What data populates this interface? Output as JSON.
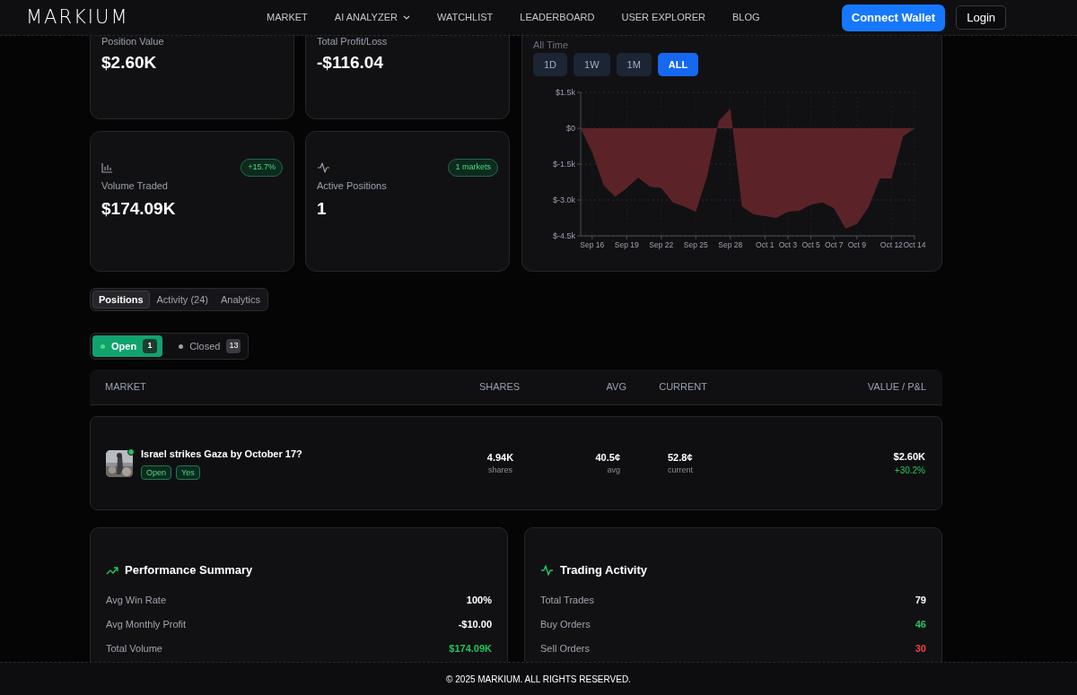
{
  "header": {
    "logo": "MARKIUM",
    "nav": [
      {
        "label": "MARKET",
        "dropdown": false
      },
      {
        "label": "AI ANALYZER",
        "dropdown": true
      },
      {
        "label": "WATCHLIST",
        "dropdown": false
      },
      {
        "label": "LEADERBOARD",
        "dropdown": false
      },
      {
        "label": "USER EXPLORER",
        "dropdown": false
      },
      {
        "label": "BLOG",
        "dropdown": false
      }
    ],
    "connect_button": "Connect Wallet",
    "login_button": "Login"
  },
  "stats": [
    {
      "label": "Position Value",
      "value": "$2.60K"
    },
    {
      "label": "Total Profit/Loss",
      "value": "-$116.04"
    },
    {
      "kind": "volume",
      "label": "Volume Traded",
      "value": "$174.09K",
      "badge": "+15.7%"
    },
    {
      "kind": "activity",
      "label": "Active Positions",
      "value": "1",
      "badge": "1 markets"
    }
  ],
  "chart_panel": {
    "period_label": "All Time",
    "ranges": [
      {
        "label": "1D",
        "selected": false
      },
      {
        "label": "1W",
        "selected": false
      },
      {
        "label": "1M",
        "selected": false
      },
      {
        "label": "ALL",
        "selected": true
      }
    ],
    "chart_data": {
      "type": "area",
      "categories": [
        null,
        "Sep 16",
        null,
        null,
        "Sep 19",
        null,
        null,
        "Sep 22",
        null,
        null,
        "Sep 25",
        null,
        null,
        "Sep 28",
        null,
        null,
        "Oct 1",
        null,
        "Oct 3",
        null,
        "Oct 5",
        null,
        "Oct 7",
        null,
        "Oct 9",
        null,
        null,
        "Oct 12",
        null,
        "Oct 14"
      ],
      "series": [
        {
          "color": "#5b2327",
          "values": [
            0,
            -1000,
            -2400,
            -2870,
            -2500,
            -2060,
            -2450,
            -2500,
            -3100,
            -3270,
            -3500,
            -2000,
            300,
            820,
            -3270,
            -3600,
            -3670,
            -3750,
            -3500,
            -3450,
            -3200,
            -3100,
            -3350,
            -4200,
            -4000,
            -3300,
            -2100,
            -2100,
            -350,
            0
          ]
        }
      ],
      "grid": true,
      "ylim": [
        -4500,
        1500
      ],
      "yticks": [
        {
          "value": 1500,
          "label": "$1.5k"
        },
        {
          "value": 0,
          "label": "$0"
        },
        {
          "value": -1500,
          "label": "$-1.5k"
        },
        {
          "value": -3000,
          "label": "$-3.0k"
        },
        {
          "value": -4500,
          "label": "$-4.5k"
        }
      ]
    }
  },
  "tabs": [
    {
      "label": "Positions",
      "selected": true
    },
    {
      "label": "Activity (24)",
      "selected": false
    },
    {
      "label": "Analytics",
      "selected": false
    }
  ],
  "filters": [
    {
      "label": "Open",
      "count": "1",
      "selected": true
    },
    {
      "label": "Closed",
      "count": "13",
      "selected": false
    }
  ],
  "table": {
    "columns": [
      "MARKET",
      "SHARES",
      "AVG",
      "CURRENT",
      "VALUE / P&L"
    ],
    "rows": [
      {
        "title": "Israel strikes Gaza by October 17?",
        "tags": [
          "Open",
          "Yes"
        ],
        "live": true,
        "shares": "4.94K",
        "shares_unit": "shares",
        "avg": "40.5¢",
        "avg_unit": "avg",
        "current": "52.8¢",
        "current_unit": "current",
        "value": "$2.60K",
        "pnl": "+30.2%"
      }
    ]
  },
  "summaries": [
    {
      "kind": "trend",
      "title": "Performance Summary",
      "rows": [
        {
          "label": "Avg Win Rate",
          "value": "100%",
          "color": "#ffffff"
        },
        {
          "label": "Avg Monthly Profit",
          "value": "-$10.00",
          "color": "#ffffff"
        },
        {
          "label": "Total Volume",
          "value": "$174.09K",
          "color": "#22c55e"
        }
      ]
    },
    {
      "kind": "activity",
      "title": "Trading Activity",
      "rows": [
        {
          "label": "Total Trades",
          "value": "79",
          "color": "#ffffff"
        },
        {
          "label": "Buy Orders",
          "value": "46",
          "color": "#22c55e"
        },
        {
          "label": "Sell Orders",
          "value": "30",
          "color": "#ef4444"
        }
      ]
    }
  ],
  "footer": "© 2025 MARKIUM. ALL RIGHTS RESERVED."
}
